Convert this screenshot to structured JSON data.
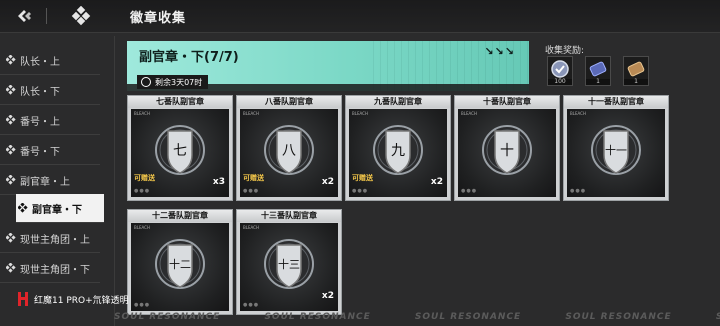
{
  "header": {
    "title": "徽章收集",
    "icons": [
      "collapse-icon",
      "diamond-grid-icon"
    ]
  },
  "sidebar": {
    "items": [
      {
        "label": "队长・上"
      },
      {
        "label": "队长・下"
      },
      {
        "label": "番号・上"
      },
      {
        "label": "番号・下"
      },
      {
        "label": "副官章・上"
      },
      {
        "label": "副官章・下",
        "active": true
      },
      {
        "label": "现世主角团・上"
      },
      {
        "label": "现世主角团・下"
      }
    ]
  },
  "banner": {
    "title": "副官章・下",
    "count": "(7/7)",
    "timer": "剩余3天07时",
    "arrows": "↘↘↘"
  },
  "rewards": {
    "label": "收集奖励:",
    "items": [
      {
        "qty": "100",
        "icon": "badge-token-icon",
        "color": "#6a7fa8"
      },
      {
        "qty": "1",
        "icon": "ticket-icon",
        "color": "#5b6ab8"
      },
      {
        "qty": "1",
        "icon": "ticket-icon",
        "color": "#b98a55"
      }
    ]
  },
  "cards": [
    {
      "title": "七番队副官章",
      "glyph": "七",
      "gift": "可赠送",
      "qty": "x3"
    },
    {
      "title": "八番队副官章",
      "glyph": "八",
      "gift": "可赠送",
      "qty": "x2"
    },
    {
      "title": "九番队副官章",
      "glyph": "九",
      "gift": "可赠送",
      "qty": "x2"
    },
    {
      "title": "十番队副官章",
      "glyph": "十",
      "gift": "",
      "qty": ""
    },
    {
      "title": "十一番队副官章",
      "glyph": "十一",
      "gift": "",
      "qty": ""
    },
    {
      "title": "十二番队副官章",
      "glyph": "十二",
      "gift": "",
      "qty": ""
    },
    {
      "title": "十三番队副官章",
      "glyph": "十三",
      "gift": "",
      "qty": "x2"
    }
  ],
  "footer": {
    "brand_text": "BLEACH",
    "strip_text": "SOUL RESONANCE",
    "watermark": "红魔11 PRO+氘锋透明"
  },
  "colors": {
    "accent": "#2bd1b2",
    "banner": "#8fe0d2",
    "gift": "#f4c74a"
  }
}
